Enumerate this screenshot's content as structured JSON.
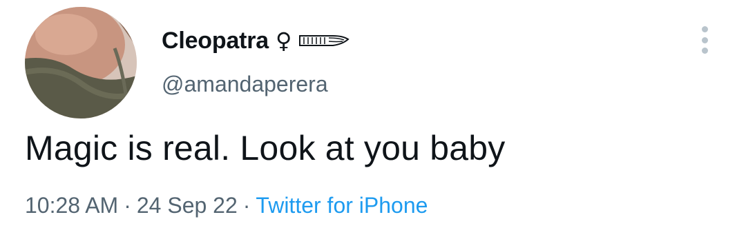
{
  "author": {
    "display_name": "Cleopatra",
    "emoji_icons": [
      "ankh-icon",
      "wing-icon"
    ],
    "handle": "@amandaperera"
  },
  "tweet": {
    "text": "Magic is real. Look at you baby",
    "time": "10:28 AM",
    "date": "24 Sep 22",
    "separator": "·",
    "source": "Twitter for iPhone"
  },
  "colors": {
    "text_primary": "#0f1419",
    "text_secondary": "#536471",
    "link": "#1d9bf0",
    "more_dots": "#b9c4cc"
  }
}
